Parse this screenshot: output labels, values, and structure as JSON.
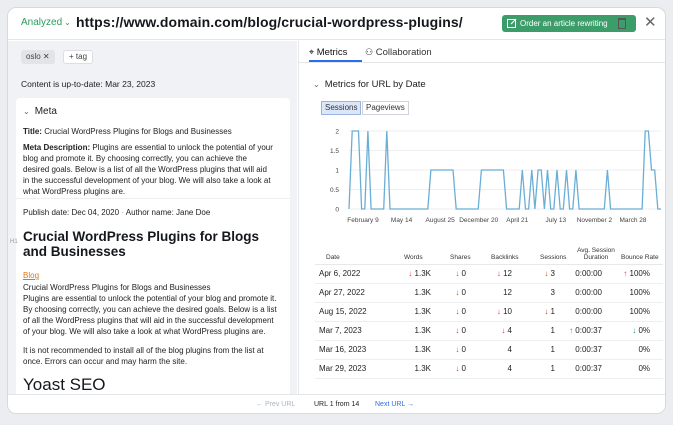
{
  "header": {
    "status": "Analyzed",
    "url": "https://www.domain.com/blog/crucial-wordpress-plugins/",
    "order_button": "Order an article rewriting"
  },
  "left": {
    "tags": [
      "oslo",
      "+ tag"
    ],
    "content_status_label": "Content is up-to-date:",
    "content_status_date": "Mar 23, 2023",
    "meta": {
      "heading": "Meta",
      "title_label": "Title:",
      "title_value": "Crucial WordPress Plugins for Blogs and Businesses",
      "desc_label": "Meta Description:",
      "desc_lines": [
        "Plugins are essential to unlock the potential of your",
        "blog and promote it. By choosing correctly, you can achieve the",
        "desired goals. Below is a list of all the WordPress plugins that will aid",
        "in the successful development of your blog. We will also take a look at",
        "what WordPress plugins are."
      ]
    },
    "content": {
      "publish": "Publish date: Dec 04, 2020",
      "author": "Author name: Jane Doe",
      "h1_marker": "H1",
      "h1": "Crucial WordPress Plugins for Blogs and Businesses",
      "blog_link": "Blog",
      "para1": [
        "Crucial WordPress Plugins for Blogs and Businesses",
        "Plugins are essential to unlock the potential of your blog and promote it.",
        "By choosing correctly, you can achieve the desired goals. Below is a list",
        "of all the WordPress plugins that will aid in the successful development",
        "of your blog. We will also take a look at what WordPress plugins are."
      ],
      "para2": [
        "It is not recommended to install all of the blog plugins from the list at",
        "once. Errors can occur and may harm the site."
      ],
      "h2": "Yoast SEO"
    }
  },
  "right": {
    "tabs": [
      "Metrics",
      "Collaboration"
    ],
    "section_title": "Metrics for URL by Date",
    "toggles": [
      "Sessions",
      "Pageviews"
    ],
    "table": {
      "headers": [
        "Date",
        "Words",
        "Shares",
        "Backlinks",
        "Sessions",
        "Avg. Session Duration",
        "Bounce Rate"
      ],
      "rows": [
        {
          "date": "Apr 6, 2022",
          "words": "1.3K",
          "words_arrow": "down",
          "shares": "0",
          "shares_arrow": "down",
          "backlinks": "12",
          "backlinks_arrow": "down",
          "sessions": "3",
          "sessions_arrow": "down",
          "duration": "0:00:00",
          "duration_arrow": "",
          "bounce": "100%",
          "bounce_arrow": "up-red"
        },
        {
          "date": "Apr 27, 2022",
          "words": "1.3K",
          "words_arrow": "",
          "shares": "0",
          "shares_arrow": "down",
          "backlinks": "12",
          "backlinks_arrow": "",
          "sessions": "3",
          "sessions_arrow": "",
          "duration": "0:00:00",
          "duration_arrow": "",
          "bounce": "100%",
          "bounce_arrow": ""
        },
        {
          "date": "Aug 15, 2022",
          "words": "1.3K",
          "words_arrow": "",
          "shares": "0",
          "shares_arrow": "down",
          "backlinks": "10",
          "backlinks_arrow": "down",
          "sessions": "1",
          "sessions_arrow": "down",
          "duration": "0:00:00",
          "duration_arrow": "",
          "bounce": "100%",
          "bounce_arrow": ""
        },
        {
          "date": "Mar 7, 2023",
          "words": "1.3K",
          "words_arrow": "",
          "shares": "0",
          "shares_arrow": "down",
          "backlinks": "4",
          "backlinks_arrow": "down",
          "sessions": "1",
          "sessions_arrow": "",
          "duration": "0:00:37",
          "duration_arrow": "up-green",
          "bounce": "0%",
          "bounce_arrow": "down-green"
        },
        {
          "date": "Mar 16, 2023",
          "words": "1.3K",
          "words_arrow": "",
          "shares": "0",
          "shares_arrow": "down",
          "backlinks": "4",
          "backlinks_arrow": "",
          "sessions": "1",
          "sessions_arrow": "",
          "duration": "0:00:37",
          "duration_arrow": "",
          "bounce": "0%",
          "bounce_arrow": ""
        },
        {
          "date": "Mar 29, 2023",
          "words": "1.3K",
          "words_arrow": "",
          "shares": "0",
          "shares_arrow": "down",
          "backlinks": "4",
          "backlinks_arrow": "",
          "sessions": "1",
          "sessions_arrow": "",
          "duration": "0:00:37",
          "duration_arrow": "",
          "bounce": "0%",
          "bounce_arrow": ""
        }
      ]
    }
  },
  "footer": {
    "prev": "← Prev URL",
    "counter": "URL 1 from 14",
    "next": "Next URL →"
  },
  "colors": {
    "accent_green": "#3c9d6a",
    "link_blue": "#2b6de8",
    "chart_line": "#6aaed6",
    "down_red": "#d9433a",
    "up_green": "#2a9a58"
  },
  "chart_data": {
    "type": "line",
    "title": "",
    "ylim": [
      0,
      2
    ],
    "yticks": [
      0,
      0.5,
      1,
      1.5,
      2
    ],
    "xtick_labels": [
      "February 9",
      "May 14",
      "August 25",
      "December 20",
      "April 21",
      "July 13",
      "November 2",
      "March 28"
    ],
    "series": [
      {
        "values": [
          0,
          2,
          2,
          2,
          0,
          0,
          2,
          0,
          0,
          0,
          0,
          0,
          2,
          0,
          0,
          0,
          0,
          0,
          0,
          0,
          0,
          0,
          0,
          0,
          0,
          0,
          1,
          1,
          1,
          1,
          1,
          1,
          1,
          1,
          0,
          0,
          0,
          0,
          0,
          0,
          0,
          0,
          1,
          1,
          1,
          1,
          1,
          1,
          1,
          1,
          0,
          0,
          0,
          0,
          0,
          1,
          0,
          0,
          1,
          0,
          1,
          1,
          0,
          1,
          0,
          0,
          1,
          0,
          0,
          1,
          0,
          0,
          1,
          0,
          0,
          0,
          0,
          0,
          0,
          0,
          0,
          0,
          1,
          0,
          0,
          0,
          0,
          0,
          0,
          0,
          0,
          0,
          0,
          0,
          2,
          2,
          1,
          1,
          0,
          0
        ]
      }
    ]
  }
}
